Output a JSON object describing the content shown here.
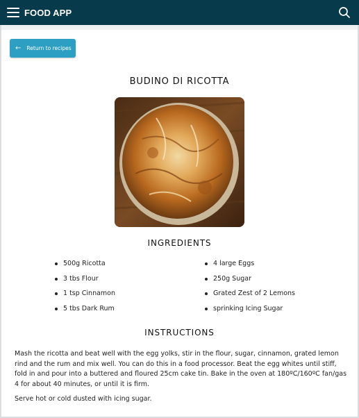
{
  "navbar": {
    "title": "FOOD APP",
    "menu_icon": "hamburger-menu-icon",
    "search_icon": "search-icon",
    "background": "#073a4b"
  },
  "return_button": {
    "label": "Return to recipes",
    "icon": "arrow-left-icon",
    "color": "#2c9fc2"
  },
  "recipe": {
    "title": "BUDINO DI RICOTTA",
    "ingredients_heading": "INGREDIENTS",
    "ingredients_left": [
      "500g Ricotta",
      "3 tbs Flour",
      "1 tsp Cinnamon",
      "5 tbs Dark Rum"
    ],
    "ingredients_right": [
      "4 large Eggs",
      "250g Sugar",
      "Grated Zest of 2 Lemons",
      "sprinking Icing Sugar"
    ],
    "instructions_heading": "INSTRUCTIONS",
    "instructions": [
      "Mash the ricotta and beat well with the egg yolks, stir in the flour, sugar, cinnamon, grated lemon rind and the rum and mix well. You can do this in a food processor. Beat the egg whites until stiff, fold in and pour into a buttered and floured 25cm cake tin. Bake in the oven at 180ºC/160ºC fan/gas 4 for about 40 minutes, or until it is firm.",
      "Serve hot or cold dusted with icing sugar."
    ]
  }
}
